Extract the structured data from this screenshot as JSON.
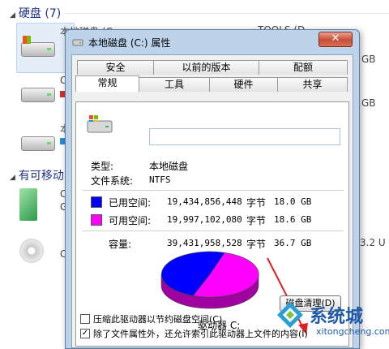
{
  "explorer": {
    "groups": [
      {
        "label": "硬盘 (7)"
      },
      {
        "label": "有可移动"
      }
    ],
    "fragments": {
      "local_disk_label": "本地磁盘 (C",
      "tools_label": "TOOLS (D",
      "right_gb_1": "GB",
      "right_gb_2": "GB",
      "left_c_1": "C",
      "left_c_2": "本",
      "left_c_3": "C",
      "left_g": "G",
      "left_c_4": "C",
      "right_size": "3.2 U"
    }
  },
  "dialog": {
    "title": "本地磁盘 (C:) 属性",
    "close_label": "✕",
    "tabs_row1": [
      "安全",
      "以前的版本",
      "配额"
    ],
    "tabs_row2": [
      "常规",
      "工具",
      "硬件",
      "共享"
    ],
    "name_value": "",
    "type_label": "类型:",
    "type_value": "本地磁盘",
    "fs_label": "文件系统:",
    "fs_value": "NTFS",
    "used_label": "已用空间:",
    "used_bytes": "19,434,856,448",
    "used_unit": "字节",
    "used_gb": "18.0 GB",
    "free_label": "可用空间:",
    "free_bytes": "19,997,102,080",
    "free_unit": "字节",
    "free_gb": "18.6 GB",
    "capacity_label": "容量:",
    "capacity_bytes": "39,431,958,528",
    "capacity_unit": "字节",
    "capacity_gb": "36.7 GB",
    "drive_label": "驱动器 C:",
    "cleanup_button": "磁盘清理(D)",
    "compress_label": "压缩此驱动器以节约磁盘空间(C)",
    "index_label": "除了文件属性外，还允许索引此驱动器上文件的内容(I)",
    "compress_checked": false,
    "index_checked": true
  },
  "pie": {
    "used_fraction": 0.4929,
    "free_fraction": 0.5071
  },
  "colors": {
    "used": "#0000ff",
    "free": "#ff00ff",
    "arrow": "#e02020"
  },
  "watermark": {
    "brand": "系统城",
    "url": "xitongcheng.com"
  }
}
